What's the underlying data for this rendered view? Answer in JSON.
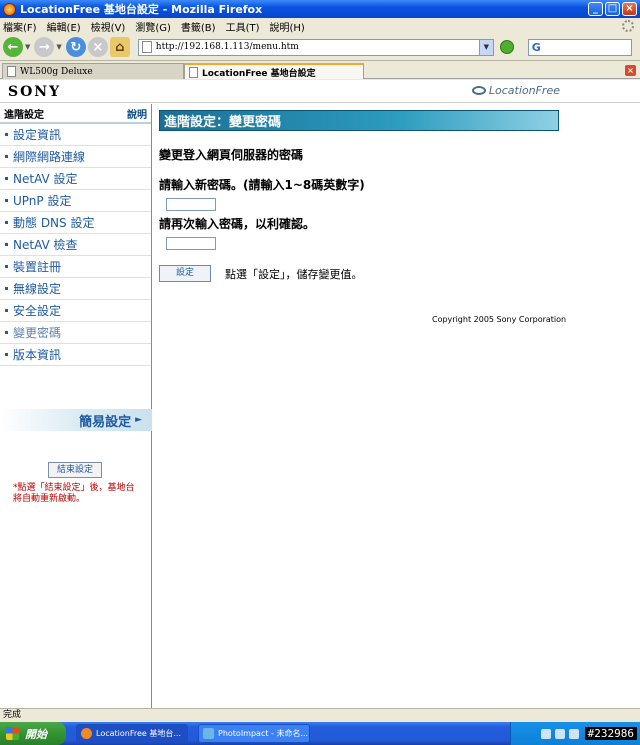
{
  "window": {
    "title": "LocationFree 基地台設定 - Mozilla Firefox",
    "buttons": [
      "_",
      "□",
      "×"
    ]
  },
  "menu": [
    "檔案(F)",
    "編輯(E)",
    "檢視(V)",
    "瀏覽(G)",
    "書籤(B)",
    "工具(T)",
    "說明(H)"
  ],
  "toolbar": {
    "url": "http://192.168.1.113/menu.htm",
    "search_prefix": "G"
  },
  "tabs": [
    {
      "label": "WL500g Deluxe",
      "active": false
    },
    {
      "label": "LocationFree 基地台設定",
      "active": true
    }
  ],
  "header": {
    "brand": "SONY",
    "product": "LocationFree"
  },
  "sidebar": {
    "title": "進階設定",
    "help": "說明",
    "items": [
      {
        "label": "設定資訊"
      },
      {
        "label": "網際網路連線"
      },
      {
        "label": "NetAV 設定"
      },
      {
        "label": "UPnP 設定"
      },
      {
        "label": "動態 DNS 設定"
      },
      {
        "label": "NetAV 檢查"
      },
      {
        "label": "裝置註冊"
      },
      {
        "label": "無線設定"
      },
      {
        "label": "安全設定"
      },
      {
        "label": "變更密碼"
      },
      {
        "label": "版本資訊"
      }
    ],
    "easy_setup": "簡易設定",
    "finish_button": "結束設定",
    "finish_note": "*點選「結束設定」後，基地台將自動重新啟動。"
  },
  "main": {
    "page_title": "進階設定：變更密碼",
    "subtitle": "變更登入網頁伺服器的密碼",
    "new_password_label": "請輸入新密碼。(請輸入1~8碼英數字)",
    "new_password_value": "",
    "confirm_password_label": "請再次輸入密碼，以利確認。",
    "confirm_password_value": "",
    "set_button": "設定",
    "set_hint": "點選「設定」，儲存變更值。",
    "copyright": "Copyright 2005 Sony Corporation"
  },
  "status": {
    "text": "完成"
  },
  "taskbar": {
    "start": "開始",
    "items": [
      "LocationFree 基地台...",
      "PhotoImpact - 未命名..."
    ],
    "clock": "#232986"
  }
}
